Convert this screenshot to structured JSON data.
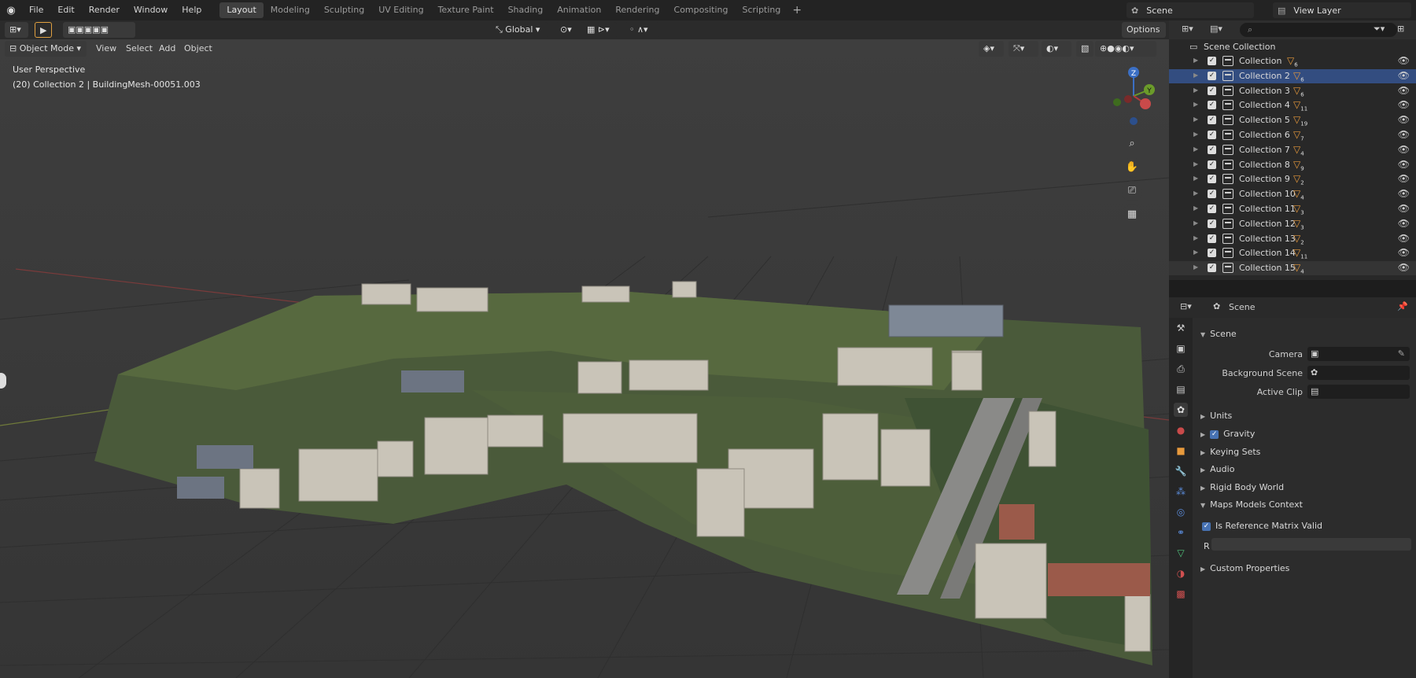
{
  "menu": {
    "items": [
      "File",
      "Edit",
      "Render",
      "Window",
      "Help"
    ]
  },
  "workspaces": {
    "tabs": [
      "Layout",
      "Modeling",
      "Sculpting",
      "UV Editing",
      "Texture Paint",
      "Shading",
      "Animation",
      "Rendering",
      "Compositing",
      "Scripting"
    ],
    "active": "Layout"
  },
  "scene_selector": {
    "value": "Scene"
  },
  "view_layer_selector": {
    "value": "View Layer"
  },
  "viewport": {
    "mode": "Object Mode",
    "menus": [
      "View",
      "Select",
      "Add",
      "Object"
    ],
    "orientation": "Global",
    "options": "Options",
    "view_name": "User Perspective",
    "context_info": "(20) Collection 2 | BuildingMesh-00051.003",
    "gizmo_axes": {
      "z": "Z",
      "y": "Y"
    }
  },
  "outliner": {
    "search_placeholder": "",
    "root": "Scene Collection",
    "collections": [
      {
        "name": "Collection",
        "count": "6",
        "selected": false
      },
      {
        "name": "Collection 2",
        "count": "6",
        "selected": true
      },
      {
        "name": "Collection 3",
        "count": "6",
        "selected": false
      },
      {
        "name": "Collection 4",
        "count": "11",
        "selected": false
      },
      {
        "name": "Collection 5",
        "count": "19",
        "selected": false
      },
      {
        "name": "Collection 6",
        "count": "7",
        "selected": false
      },
      {
        "name": "Collection 7",
        "count": "4",
        "selected": false
      },
      {
        "name": "Collection 8",
        "count": "9",
        "selected": false
      },
      {
        "name": "Collection 9",
        "count": "2",
        "selected": false
      },
      {
        "name": "Collection 10",
        "count": "4",
        "selected": false
      },
      {
        "name": "Collection 11",
        "count": "3",
        "selected": false
      },
      {
        "name": "Collection 12",
        "count": "3",
        "selected": false
      },
      {
        "name": "Collection 13",
        "count": "2",
        "selected": false
      },
      {
        "name": "Collection 14",
        "count": "11",
        "selected": false
      },
      {
        "name": "Collection 15",
        "count": "4",
        "selected": false
      }
    ]
  },
  "properties": {
    "header_title": "Scene",
    "scene_panel": {
      "title": "Scene",
      "camera_label": "Camera",
      "background_scene_label": "Background Scene",
      "active_clip_label": "Active Clip"
    },
    "sections": {
      "units": "Units",
      "gravity": "Gravity",
      "keying_sets": "Keying Sets",
      "audio": "Audio",
      "rigid_body_world": "Rigid Body World",
      "maps_models_context": "Maps Models Context",
      "is_ref_matrix_valid": "Is Reference Matrix Valid",
      "r_label": "R",
      "custom_properties": "Custom Properties"
    }
  }
}
